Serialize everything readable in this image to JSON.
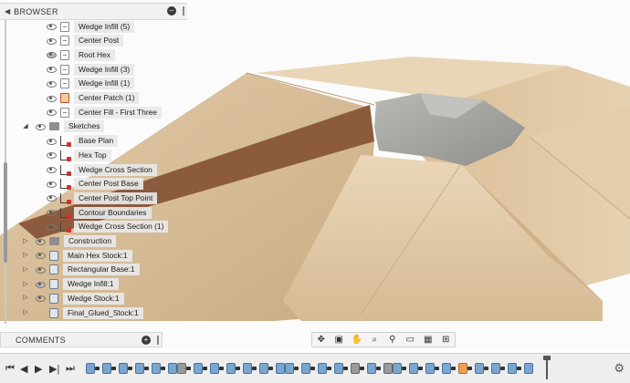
{
  "browser": {
    "title": "BROWSER",
    "collapse_icon": "triangle-left-icon",
    "pin_icon": "circle-minus-icon"
  },
  "tree": [
    {
      "label": "Wedge Infill (5)",
      "icon": "body",
      "eye": "open",
      "level": 2
    },
    {
      "label": "Center Post",
      "icon": "body",
      "eye": "open",
      "level": 2
    },
    {
      "label": "Root Hex",
      "icon": "body",
      "eye": "solid",
      "level": 2
    },
    {
      "label": "Wedge Infill (3)",
      "icon": "body",
      "eye": "open",
      "level": 2
    },
    {
      "label": "Wedge Infill (1)",
      "icon": "body",
      "eye": "open",
      "level": 2
    },
    {
      "label": "Center Patch (1)",
      "icon": "patch",
      "eye": "open",
      "level": 2
    },
    {
      "label": "Center Fill - First Three",
      "icon": "body",
      "eye": "open",
      "level": 2
    },
    {
      "label": "Sketches",
      "icon": "folder",
      "eye": "open",
      "level": 1,
      "expanded": true
    },
    {
      "label": "Base Plan",
      "icon": "sketch",
      "eye": "open",
      "level": 2
    },
    {
      "label": "Hex Top",
      "icon": "sketch",
      "eye": "open",
      "level": 2
    },
    {
      "label": "Wedge Cross Section",
      "icon": "sketch",
      "eye": "open",
      "level": 2
    },
    {
      "label": "Center Post Base",
      "icon": "sketch",
      "eye": "open",
      "level": 2
    },
    {
      "label": "Center Post Top Point",
      "icon": "sketch",
      "eye": "open",
      "level": 2
    },
    {
      "label": "Contour Boundaries",
      "icon": "sketch",
      "eye": "open",
      "level": 2
    },
    {
      "label": "Wedge Cross Section (1)",
      "icon": "sketch",
      "eye": "open",
      "level": 2
    },
    {
      "label": "Construction",
      "icon": "folder",
      "eye": "open",
      "level": 0,
      "expanded": false
    },
    {
      "label": "Main Hex Stock:1",
      "icon": "comp",
      "eye": "open",
      "level": 0,
      "expanded": false
    },
    {
      "label": "Rectangular Base:1",
      "icon": "comp",
      "eye": "open",
      "level": 0,
      "expanded": false
    },
    {
      "label": "Wedge Infill:1",
      "icon": "comp",
      "eye": "solid",
      "level": 0,
      "expanded": false
    },
    {
      "label": "Wedge Stock:1",
      "icon": "comp",
      "eye": "open",
      "level": 0,
      "expanded": false
    },
    {
      "label": "Final_Glued_Stock:1",
      "icon": "comp",
      "eye": "none",
      "level": 0,
      "expanded": false
    }
  ],
  "comments": {
    "title": "COMMENTS"
  },
  "navbar": {
    "icons": [
      "orbit-icon",
      "camera-icon",
      "pan-hand-icon",
      "zoom-window-icon",
      "zoom-icon",
      "display-icon",
      "visual-style-icon",
      "grid-icon"
    ]
  },
  "timeline": {
    "controls": [
      "go-to-start-icon",
      "step-back-icon",
      "play-icon",
      "step-forward-icon",
      "go-to-end-icon"
    ],
    "colors": {
      "wood_light": "#dcc39f",
      "wood_dark": "#8c5a3c",
      "stone": "#a8a8a4",
      "accent_blue": "#7aa6cf"
    }
  }
}
